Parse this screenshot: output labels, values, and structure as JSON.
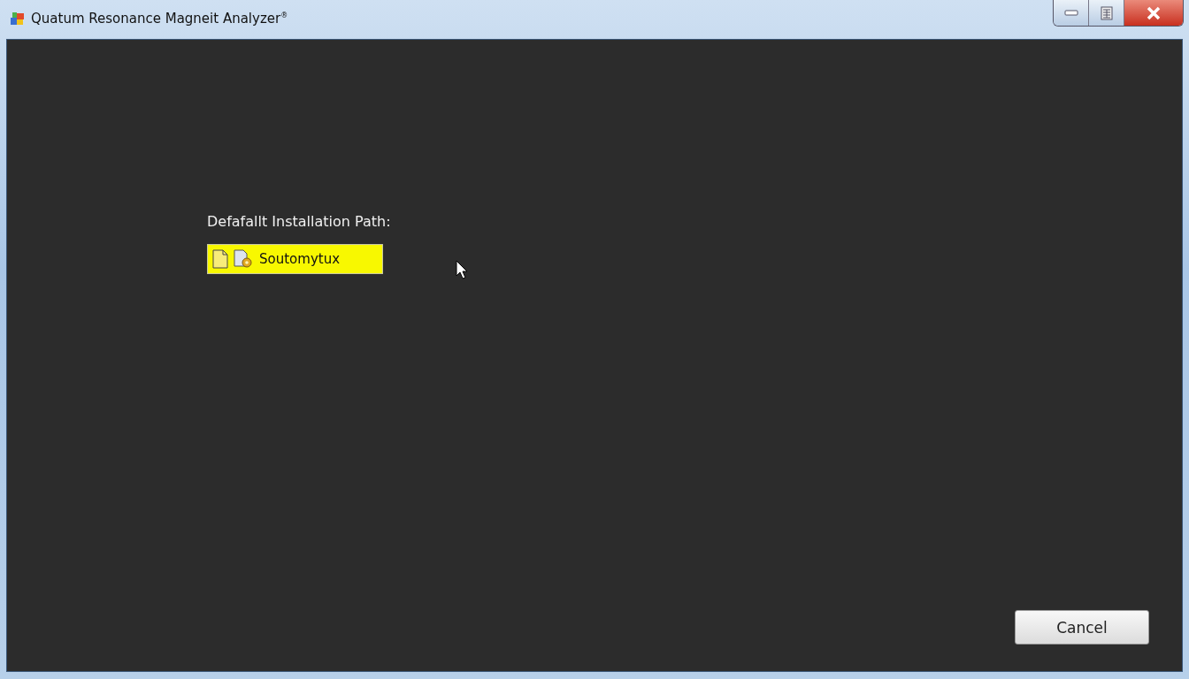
{
  "window": {
    "title": "Quatum Resonance Magneit Analyzer$^{®}$"
  },
  "install_path": {
    "label": "Defafallt Installation Path:",
    "value": "Soutomytux"
  },
  "buttons": [
    {
      "label": "Cancel"
    }
  ]
}
